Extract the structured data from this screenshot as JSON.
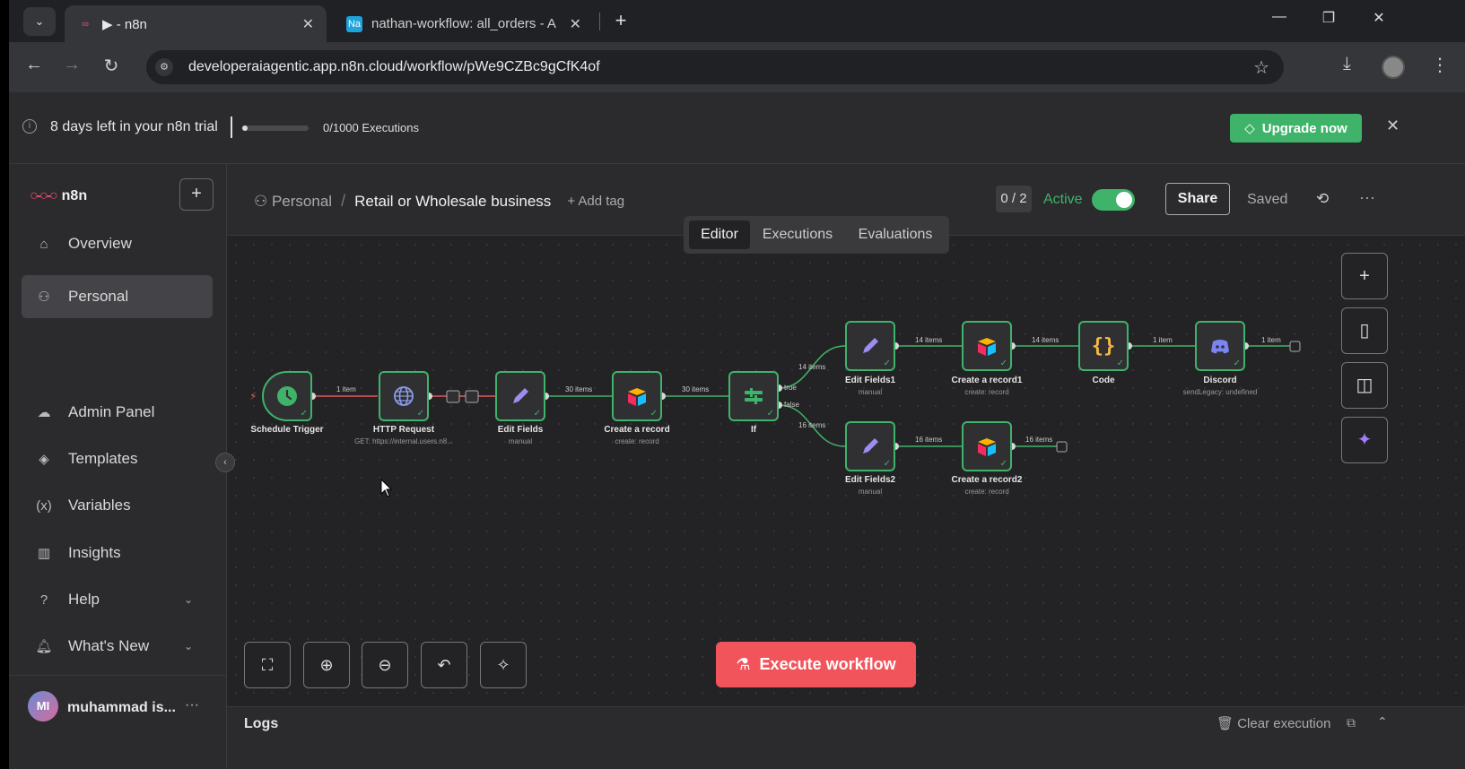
{
  "browser": {
    "tabs": [
      {
        "title": "▶ - n8n",
        "active": true
      },
      {
        "title": "nathan-workflow: all_orders - A",
        "active": false
      }
    ],
    "url": "developeraiagentic.app.n8n.cloud/workflow/pWe9CZBc9gCfK4of"
  },
  "banner": {
    "trial_text": "8 days left in your n8n trial",
    "executions": "0/1000 Executions",
    "executions_used_fraction": 0.0,
    "upgrade_label": "Upgrade now"
  },
  "sidebar": {
    "brand": "n8n",
    "items": [
      {
        "label": "Overview",
        "icon": "home-icon"
      },
      {
        "label": "Personal",
        "icon": "user-icon"
      },
      {
        "label": "Admin Panel",
        "icon": "cloud-icon"
      },
      {
        "label": "Templates",
        "icon": "box-icon"
      },
      {
        "label": "Variables",
        "icon": "variable-icon"
      },
      {
        "label": "Insights",
        "icon": "chart-icon"
      },
      {
        "label": "Help",
        "icon": "help-icon"
      },
      {
        "label": "What's New",
        "icon": "bell-icon"
      }
    ],
    "user": {
      "initials": "MI",
      "name": "muhammad is..."
    }
  },
  "header": {
    "project": "Personal",
    "workflow_name": "Retail or Wholesale business",
    "add_tag": "+ Add tag",
    "counter": "0 / 2",
    "active_label": "Active",
    "share_label": "Share",
    "saved_label": "Saved"
  },
  "mode_tabs": [
    "Editor",
    "Executions",
    "Evaluations"
  ],
  "nodes": {
    "schedule": {
      "label": "Schedule Trigger",
      "sub": ""
    },
    "http": {
      "label": "HTTP Request",
      "sub": "GET: https://internal.users.n8..."
    },
    "edit": {
      "label": "Edit Fields",
      "sub": "manual"
    },
    "create": {
      "label": "Create a record",
      "sub": "create: record"
    },
    "if": {
      "label": "If",
      "sub": ""
    },
    "edit1": {
      "label": "Edit Fields1",
      "sub": "manual"
    },
    "create1": {
      "label": "Create a record1",
      "sub": "create: record"
    },
    "code": {
      "label": "Code",
      "sub": ""
    },
    "discord": {
      "label": "Discord",
      "sub": "sendLegacy: undefined"
    },
    "edit2": {
      "label": "Edit Fields2",
      "sub": "manual"
    },
    "create2": {
      "label": "Create a record2",
      "sub": "create: record"
    }
  },
  "edges": {
    "e1": "1 item",
    "e2": "30 items",
    "e3": "30 items",
    "if_true": "true",
    "if_false": "false",
    "e4": "14 items",
    "e5": "14 items",
    "e6": "14 items",
    "e7": "1 item",
    "e8": "1 item",
    "e9": "16 items",
    "e10": "16 items",
    "e11": "16 items"
  },
  "execute_label": "Execute workflow",
  "logs": {
    "title": "Logs",
    "clear_label": "Clear execution"
  },
  "colors": {
    "accent": "#3fb36a",
    "execute": "#f2545b",
    "brand": "#ea4b71"
  }
}
